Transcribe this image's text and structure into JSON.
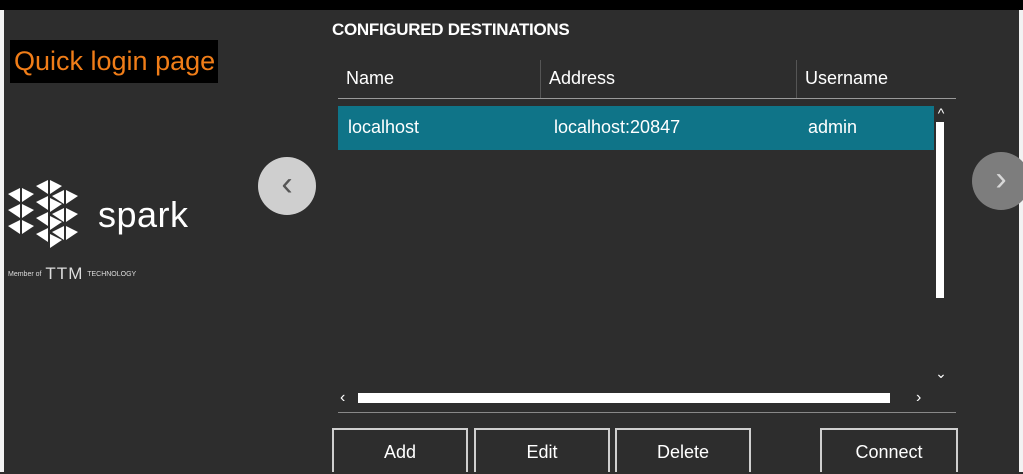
{
  "page_title": "Quick login page",
  "logo": {
    "name": "spark",
    "member_prefix": "Member of",
    "ttm": "TTM",
    "technology": "TECHNOLOGY"
  },
  "section_title": "CONFIGURED DESTINATIONS",
  "columns": [
    "Name",
    "Address",
    "Username"
  ],
  "rows": [
    {
      "name": "localhost",
      "address": "localhost:20847",
      "username": "admin"
    }
  ],
  "buttons": {
    "add": "Add",
    "edit": "Edit",
    "delete": "Delete",
    "connect": "Connect"
  },
  "icons": {
    "prev": "chevron-left-icon",
    "next": "chevron-right-icon",
    "scroll_up": "chevron-up-icon",
    "scroll_down": "chevron-down-icon"
  },
  "colors": {
    "title_text": "#f07d18",
    "selected_row": "#0f7488",
    "background": "#2d2d2d"
  }
}
